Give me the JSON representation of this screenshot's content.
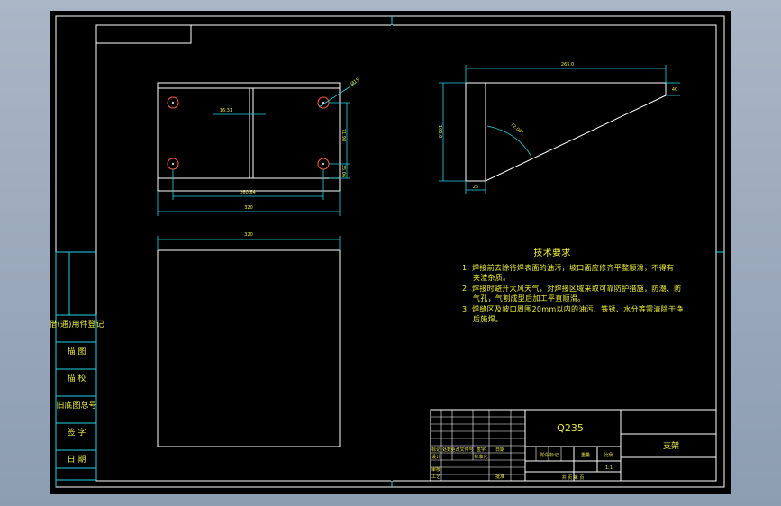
{
  "drawing": {
    "material": "Q235",
    "part_name": "支架",
    "scale": "1:1",
    "sheet_info": "共 页 第 页"
  },
  "dimensions": {
    "top_view_width": "320",
    "top_view_hole_spacing": "260.64",
    "top_view_gap": "16.31",
    "top_view_vertical": "71.98",
    "top_view_edge": "35.06",
    "hole_diameter": "Ø15",
    "front_view_width": "320",
    "side_view_length": "265.0",
    "side_view_height": "100.0",
    "side_view_base": "25",
    "side_view_tip": "40",
    "side_view_angle": "72.00°"
  },
  "technical_requirements": {
    "title": "技术要求",
    "lines": [
      "1. 焊接前去除待焊表面的油污，坡口面应修齐平整顺滑，不得有",
      "夹渣杂质。",
      "2. 焊接时避开大风天气，对焊接区域采取可靠防护措施，防潮、防",
      "气孔，气割成型后加工平直顺滑。",
      "3. 焊缝区及坡口周围20mm以内的油污、铁锈、水分等需清除干净",
      "后施焊。"
    ]
  },
  "left_panel": [
    "借(通)用件登记",
    "描 图",
    "描 校",
    "旧底图总号",
    "签 字",
    "日 期"
  ],
  "title_block_labels": {
    "mark": "标记",
    "count": "处数",
    "change_doc": "更改文件号",
    "signature": "签字",
    "date": "日期",
    "design": "设计",
    "check": "审核",
    "process": "工艺",
    "standard": "标准化",
    "approve": "批准",
    "stage_mark": "阶段标记",
    "weight": "重量",
    "scale_label": "比例"
  }
}
